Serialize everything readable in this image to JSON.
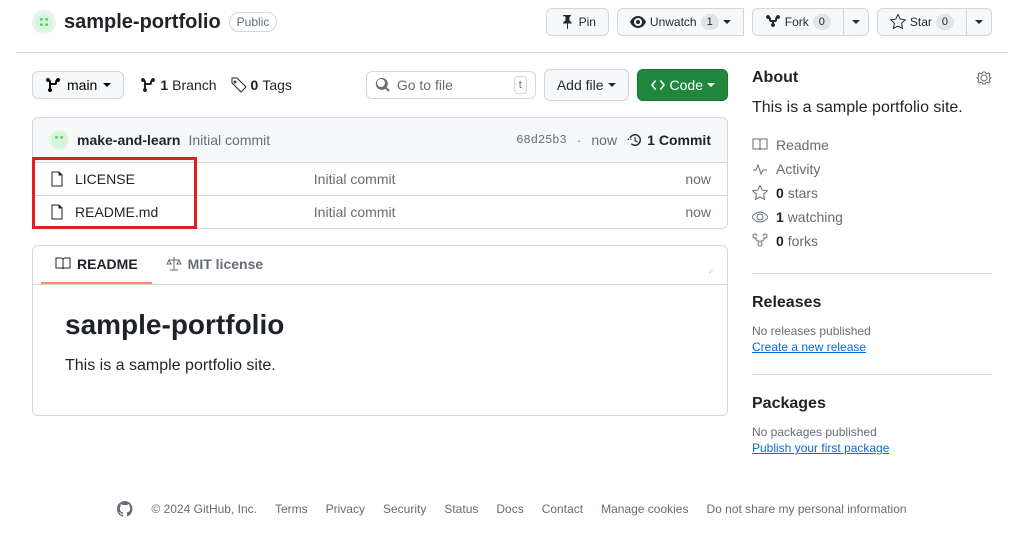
{
  "repo": {
    "name": "sample-portfolio",
    "visibility": "Public"
  },
  "actions": {
    "pin": "Pin",
    "unwatch": "Unwatch",
    "unwatch_count": "1",
    "fork": "Fork",
    "fork_count": "0",
    "star": "Star",
    "star_count": "0"
  },
  "nav": {
    "branch": "main",
    "branches_count": "1",
    "branches_label": "Branch",
    "tags_count": "0",
    "tags_label": "Tags",
    "search_placeholder": "Go to file",
    "kbd": "t",
    "add_file": "Add file",
    "code": "Code"
  },
  "commit_header": {
    "author": "make-and-learn",
    "message": "Initial commit",
    "sha": "68d25b3",
    "time": "now",
    "commits_count": "1",
    "commits_label": "Commit"
  },
  "files": [
    {
      "name": "LICENSE",
      "message": "Initial commit",
      "time": "now"
    },
    {
      "name": "README.md",
      "message": "Initial commit",
      "time": "now"
    }
  ],
  "readme": {
    "tab_readme": "README",
    "tab_license": "MIT license",
    "title": "sample-portfolio",
    "body": "This is a sample portfolio site."
  },
  "about": {
    "heading": "About",
    "description": "This is a sample portfolio site.",
    "readme_link": "Readme",
    "activity_link": "Activity",
    "stars": "0",
    "stars_label": "stars",
    "watching": "1",
    "watching_label": "watching",
    "forks": "0",
    "forks_label": "forks"
  },
  "releases": {
    "heading": "Releases",
    "empty": "No releases published",
    "link": "Create a new release"
  },
  "packages": {
    "heading": "Packages",
    "empty": "No packages published",
    "link": "Publish your first package"
  },
  "footer": {
    "copyright": "© 2024 GitHub, Inc.",
    "links": [
      "Terms",
      "Privacy",
      "Security",
      "Status",
      "Docs",
      "Contact",
      "Manage cookies",
      "Do not share my personal information"
    ]
  }
}
